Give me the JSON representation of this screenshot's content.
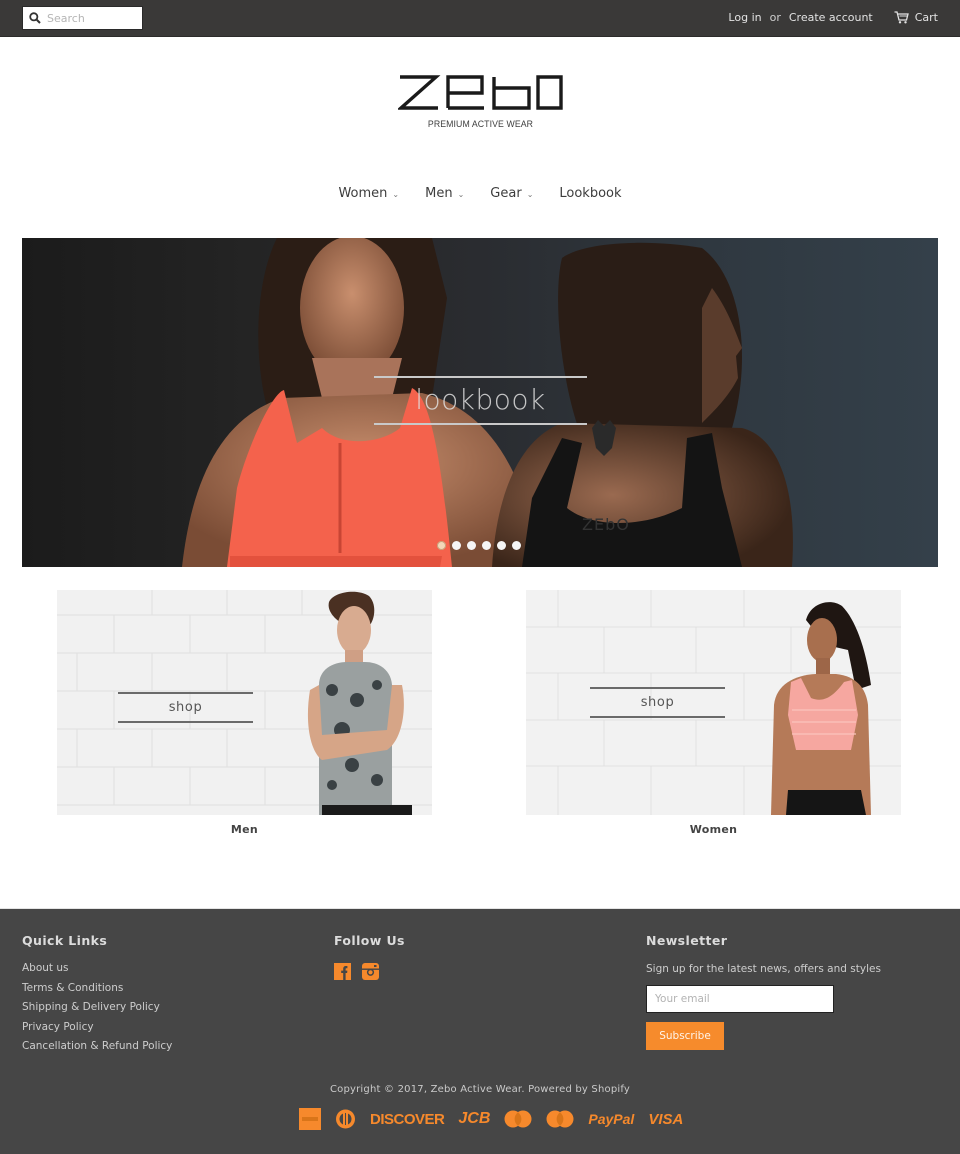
{
  "topbar": {
    "search_placeholder": "Search",
    "login_label": "Log in",
    "or_label": "or",
    "create_account_label": "Create account",
    "cart_label": "Cart"
  },
  "brand": {
    "logo_text": "ZEbO",
    "tagline": "PREMIUM ACTIVE WEAR"
  },
  "nav": {
    "items": [
      {
        "label": "Women",
        "has_dropdown": true
      },
      {
        "label": "Men",
        "has_dropdown": true
      },
      {
        "label": "Gear",
        "has_dropdown": true
      },
      {
        "label": "Lookbook",
        "has_dropdown": false
      }
    ],
    "chevron": "⌄"
  },
  "hero": {
    "label": "lookbook",
    "slides_total": 6,
    "active_slide": 1
  },
  "collections": [
    {
      "title": "Men",
      "overlay_label": "shop"
    },
    {
      "title": "Women",
      "overlay_label": "shop"
    }
  ],
  "footer": {
    "quick_links": {
      "heading": "Quick Links",
      "links": [
        "About us",
        "Terms & Conditions",
        "Shipping & Delivery Policy",
        "Privacy Policy",
        "Cancellation & Refund Policy"
      ]
    },
    "follow": {
      "heading": "Follow Us",
      "icons": [
        "facebook-icon",
        "instagram-icon"
      ]
    },
    "newsletter": {
      "heading": "Newsletter",
      "text": "Sign up for the latest news, offers and styles",
      "email_placeholder": "Your email",
      "button_label": "Subscribe"
    },
    "copyright": {
      "prefix": "Copyright © 2017, ",
      "store_link": "Zebo Active Wear",
      "separator": ". ",
      "powered_by": "Powered by Shopify"
    },
    "payments": {
      "discover": "DISCOVER",
      "jcb": "JCB",
      "paypal": "PayPal",
      "visa": "VISA",
      "maestro": "Maestro",
      "mastercard": "MasterCard"
    }
  },
  "colors": {
    "topbar_bg": "#3a3938",
    "footer_bg": "#464646",
    "accent": "#f68b2c"
  }
}
